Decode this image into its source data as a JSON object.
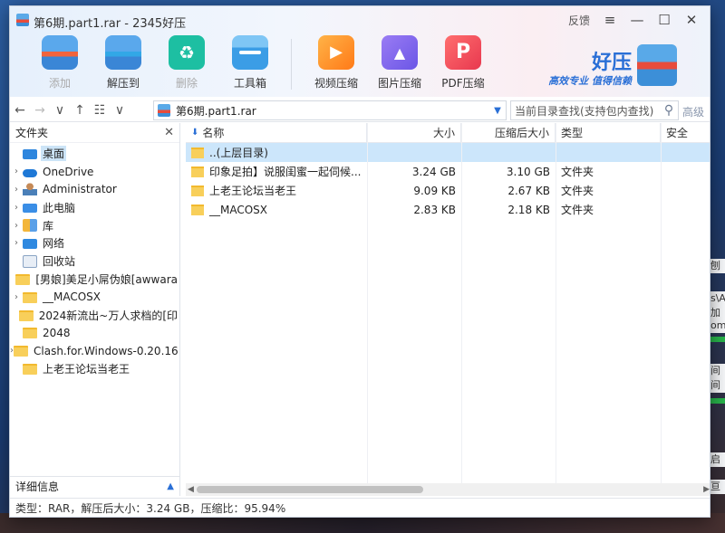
{
  "window": {
    "title": "第6期.part1.rar - 2345好压",
    "feedback": "反馈",
    "menu_icon": "≡",
    "minimize_icon": "—",
    "maximize_icon": "☐",
    "close_icon": "✕"
  },
  "toolbar": {
    "add": "添加",
    "extract": "解压到",
    "delete": "删除",
    "toolbox": "工具箱",
    "video": "视频压缩",
    "image": "图片压缩",
    "pdf": "PDF压缩"
  },
  "brand": {
    "name": "好压",
    "slogan": "高效专业  值得信赖"
  },
  "nav": {
    "back": "←",
    "forward": "→",
    "dropdown": "∨",
    "up": "↑",
    "view": "☷",
    "view_dropdown": "∨",
    "path": "第6期.part1.rar",
    "path_dropdown": "▼",
    "search_placeholder": "当前目录查找(支持包内查找)",
    "search_icon": "⚲",
    "advanced": "高级"
  },
  "left_panel": {
    "title": "文件夹",
    "close": "✕",
    "items": [
      {
        "label": "桌面",
        "arrow": "",
        "icon": "desktop"
      },
      {
        "label": "OneDrive",
        "arrow": "›",
        "icon": "cloud"
      },
      {
        "label": "Administrator",
        "arrow": "›",
        "icon": "user"
      },
      {
        "label": "此电脑",
        "arrow": "›",
        "icon": "pc"
      },
      {
        "label": "库",
        "arrow": "›",
        "icon": "lib"
      },
      {
        "label": "网络",
        "arrow": "›",
        "icon": "net"
      },
      {
        "label": "回收站",
        "arrow": "",
        "icon": "recycle"
      },
      {
        "label": "[男娘]美足小屌伪娘[awwara",
        "arrow": "",
        "icon": "folder"
      },
      {
        "label": "__MACOSX",
        "arrow": "›",
        "icon": "folder"
      },
      {
        "label": "2024新流出~万人求档的[印",
        "arrow": "",
        "icon": "folder"
      },
      {
        "label": "2048",
        "arrow": "",
        "icon": "folder"
      },
      {
        "label": "Clash.for.Windows-0.20.16",
        "arrow": "›",
        "icon": "folder"
      },
      {
        "label": "上老王论坛当老王",
        "arrow": "",
        "icon": "folder"
      }
    ],
    "footer": "详细信息",
    "footer_icon": "▲"
  },
  "file_list": {
    "headers": {
      "name": "名称",
      "size": "大小",
      "packed": "压缩后大小",
      "type": "类型",
      "security": "安全"
    },
    "sort_icon": "⬇",
    "rows": [
      {
        "name": "..(上层目录)",
        "size": "",
        "packed": "",
        "type": ""
      },
      {
        "name": "印象足拍】说服闺蜜一起伺候...",
        "size": "3.24 GB",
        "packed": "3.10 GB",
        "type": "文件夹"
      },
      {
        "name": "上老王论坛当老王",
        "size": "9.09 KB",
        "packed": "2.67 KB",
        "type": "文件夹"
      },
      {
        "name": "__MACOSX",
        "size": "2.83 KB",
        "packed": "2.18 KB",
        "type": "文件夹"
      }
    ]
  },
  "statusbar": {
    "text": "类型：RAR，解压后大小：3.24 GB，压缩比：95.94%"
  },
  "scroll": {
    "left": "◀",
    "right": "▶"
  },
  "background_peek": {
    "lines": [
      "刨",
      "s\\A",
      "加",
      "om]",
      "间",
      "间",
      "启",
      "亘"
    ]
  }
}
